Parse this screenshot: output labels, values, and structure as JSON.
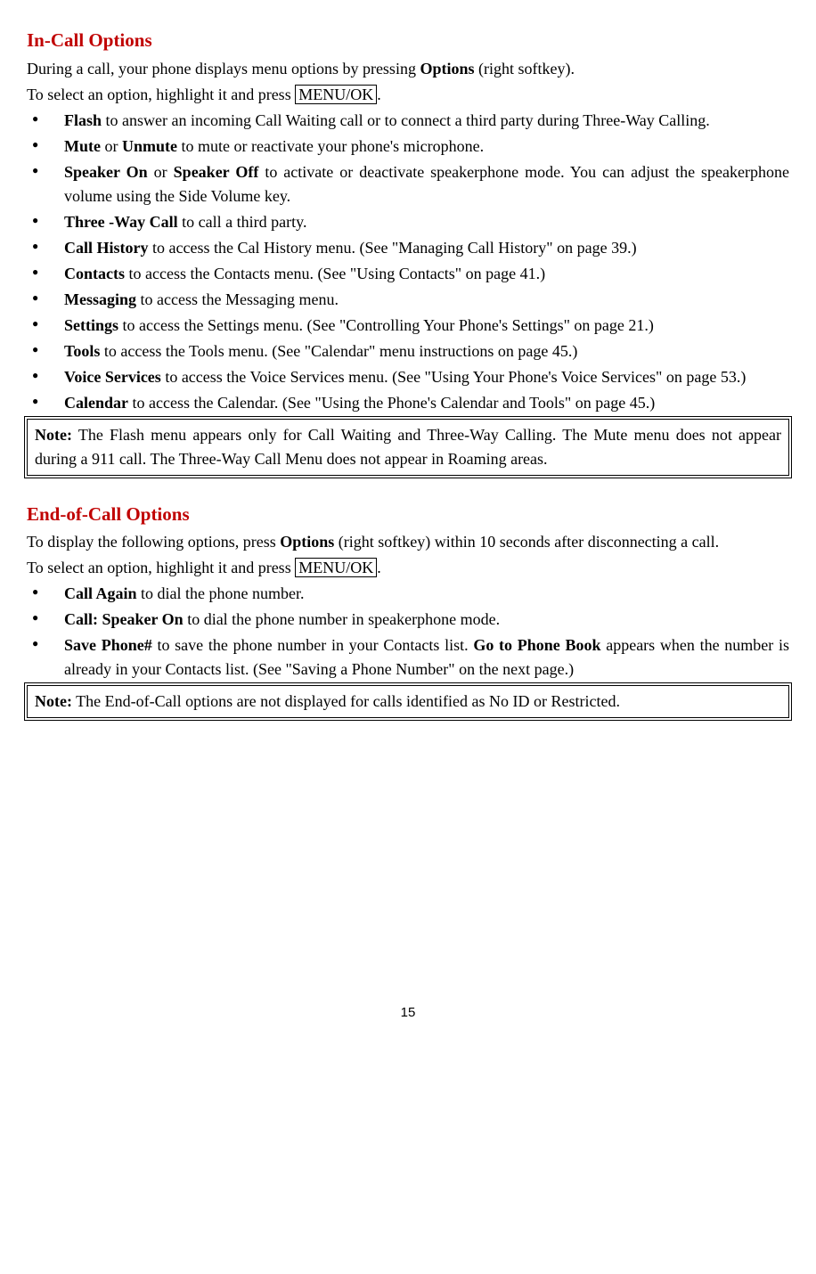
{
  "incall": {
    "heading": "In-Call Options",
    "intro1a": "During a call, your phone displays menu options by pressing ",
    "intro1b": "Options",
    "intro1c": " (right softkey).",
    "intro2a": "To select an option, highlight it and press ",
    "menuok": "MENU/OK",
    "intro2c": ".",
    "items": [
      {
        "b": "Flash",
        "t": " to answer an incoming Call Waiting call or to connect a third party during Three-Way Calling."
      },
      {
        "b": "Mute",
        "m": " or ",
        "b2": "Unmute",
        "t": " to mute or reactivate your phone's microphone."
      },
      {
        "b": "Speaker On",
        "m": " or ",
        "b2": "Speaker Off",
        "t": " to activate or deactivate speakerphone mode. You can adjust the speakerphone volume using the Side Volume key."
      },
      {
        "b": "Three -Way Call",
        "t": " to call a third party."
      },
      {
        "b": "Call History",
        "t": " to access the Cal History menu. (See \"Managing Call History\" on page 39.)"
      },
      {
        "b": "Contacts",
        "t": " to access the Contacts menu. (See \"Using Contacts\" on page 41.)"
      },
      {
        "b": "Messaging",
        "t": " to access the Messaging menu."
      },
      {
        "b": "Settings",
        "t": " to access the Settings menu. (See \"Controlling Your Phone's Settings\" on page 21.)"
      },
      {
        "b": "Tools",
        "t": " to access the Tools menu. (See \"Calendar\" menu instructions on page 45.)"
      },
      {
        "b": "Voice Services",
        "t": " to access the Voice Services menu.  (See \"Using Your Phone's Voice Services\" on page 53.)"
      },
      {
        "b": "Calendar",
        "t": " to access the Calendar. (See \"Using the Phone's Calendar and Tools\" on page 45.)"
      }
    ],
    "note_b": "Note:",
    "note_t": " The Flash menu appears only for Call Waiting and Three-Way Calling. The Mute menu does not appear during a 911 call. The Three-Way Call Menu does not appear in Roaming areas."
  },
  "endcall": {
    "heading": "End-of-Call Options",
    "intro1a": "To display the following options, press ",
    "intro1b": "Options",
    "intro1c": " (right softkey) within 10 seconds after disconnecting a call.",
    "intro2a": "To select an option, highlight it and press ",
    "menuok": "MENU/OK",
    "intro2c": ".",
    "items": [
      {
        "b": "Call Again",
        "t": " to dial the phone number."
      },
      {
        "b": "Call: Speaker On",
        "t": " to dial the phone number in speakerphone mode."
      },
      {
        "b": "Save Phone#",
        "t": " to save the phone number in your Contacts list. ",
        "b2": "Go to Phone Book",
        "t2": " appears when the number is already in your Contacts list. (See \"Saving a Phone Number\" on the next page.)"
      }
    ],
    "note_b": "Note:",
    "note_t": " The End-of-Call options are not displayed for calls identified as No ID or Restricted."
  },
  "page": "15"
}
